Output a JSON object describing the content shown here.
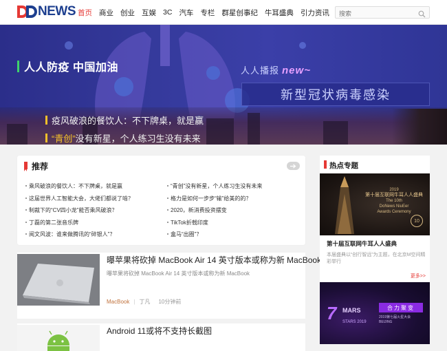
{
  "header": {
    "logo_text": "NEWS",
    "logo_prefix": "DD",
    "nav": [
      "首页",
      "商业",
      "创业",
      "互娱",
      "3C",
      "汽车",
      "专栏",
      "群星创事纪",
      "牛耳盛典",
      "引力资讯"
    ],
    "search_placeholder": "搜索"
  },
  "banner": {
    "slogan": "人人防疫 中国加油",
    "renren_prefix": "人人播报",
    "renren_new": "new~",
    "covid_title": "新型冠状病毒感染",
    "caption1": "疫风破浪的餐饮人：不下牌桌，就是赢",
    "caption2_quote": "“青创”",
    "caption2_rest": "没有新星，个人练习生没有未来"
  },
  "recommend": {
    "title": "推荐",
    "rows": [
      [
        "乘风破浪的餐饮人：不下牌桌，就是赢",
        "“青创”没有新星，个人练习生没有未来"
      ],
      [
        "这届世界人工智能大会，大佬们都说了啥？",
        "格力是如何一步步“输”给美的的？"
      ],
      [
        "制裁下的“CV四小龙”能否乘风破浪？",
        "2020，新消费投资摆变"
      ],
      [
        "丁磊的第二张音乐牌",
        "TikTok折戟印度"
      ],
      [
        "阅文风波：谁来做腾讯的“碎银人”？",
        "盒马“出圈”？"
      ]
    ]
  },
  "articles": [
    {
      "title": "曝苹果将砍掉 MacBook Air 14 英寸版本或称为新 MacBook",
      "summary": "曝苹果将砍掉 MacBook Air 14 英寸版本或称为新 MacBook",
      "tag": "MacBook",
      "author": "丁凡",
      "time": "10分钟前"
    },
    {
      "title": "Android 11或将不支持长截图",
      "summary": "",
      "tag": "",
      "author": "",
      "time": ""
    }
  ],
  "sidebar": {
    "title": "热点专题",
    "topic1": {
      "poster_year": "2019",
      "poster_title": "第十届互联网牛耳人人盛典",
      "poster_en1": "The 10th",
      "poster_en2": "DoNews NiuEer",
      "poster_en3": "Awards Ceremony",
      "poster_badge": "10",
      "headline": "第十届互联网牛耳人人盛典",
      "desc": "本届盛典以“创行智远”为主题，在北京M空间精彩举行",
      "more": "更多>>"
    },
    "topic2": {
      "big": "7",
      "mars": "MARS",
      "stars": "STARS 2019",
      "badge": "合力聚变",
      "sub": "2019第七届火星大会 BEIJING"
    }
  },
  "colors": {
    "accent": "#e53935",
    "brand_blue": "#1d3f8f",
    "banner_bg": "#353a9c",
    "gold": "#f5c02a"
  }
}
